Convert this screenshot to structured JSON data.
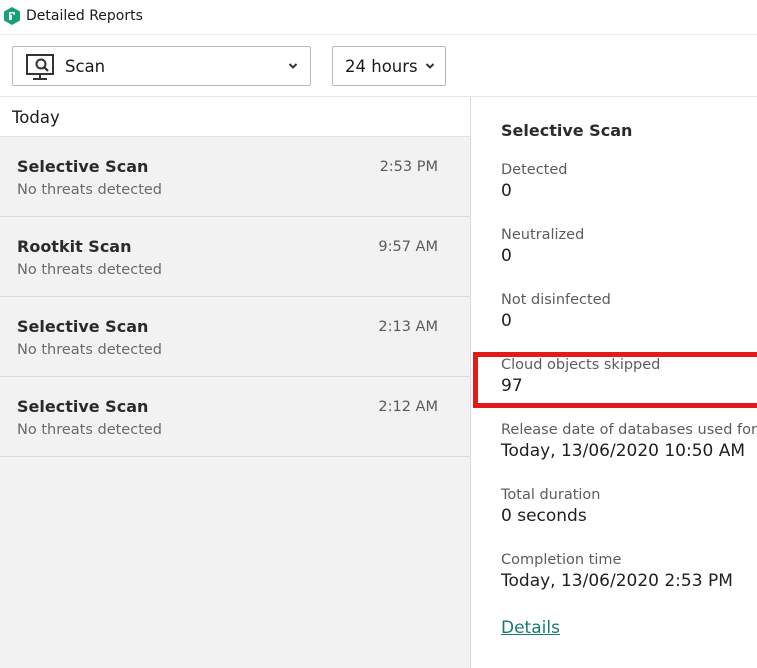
{
  "window": {
    "title": "Detailed Reports",
    "app_icon": "kaspersky-shield-icon"
  },
  "toolbar": {
    "report_type": {
      "icon": "monitor-scan-icon",
      "selected": "Scan"
    },
    "period": {
      "selected": "24 hours"
    }
  },
  "list": {
    "group_label": "Today",
    "items": [
      {
        "title": "Selective Scan",
        "status": "No threats detected",
        "time": "2:53 PM"
      },
      {
        "title": "Rootkit Scan",
        "status": "No threats detected",
        "time": "9:57 AM"
      },
      {
        "title": "Selective Scan",
        "status": "No threats detected",
        "time": "2:13 AM"
      },
      {
        "title": "Selective Scan",
        "status": "No threats detected",
        "time": "2:12 AM"
      }
    ]
  },
  "details": {
    "title": "Selective Scan",
    "fields": [
      {
        "label": "Detected",
        "value": "0"
      },
      {
        "label": "Neutralized",
        "value": "0"
      },
      {
        "label": "Not disinfected",
        "value": "0"
      },
      {
        "label": "Cloud objects skipped",
        "value": "97"
      },
      {
        "label": "Release date of databases used for scan",
        "value": "Today, 13/06/2020 10:50 AM"
      },
      {
        "label": "Total duration",
        "value": "0 seconds"
      },
      {
        "label": "Completion time",
        "value": "Today, 13/06/2020 2:53 PM"
      }
    ],
    "link_label": "Details"
  },
  "colors": {
    "highlight": "#e31a1a",
    "link": "#157a6e",
    "list_background": "#f2f2f2",
    "brand_green": "#159f7b"
  }
}
